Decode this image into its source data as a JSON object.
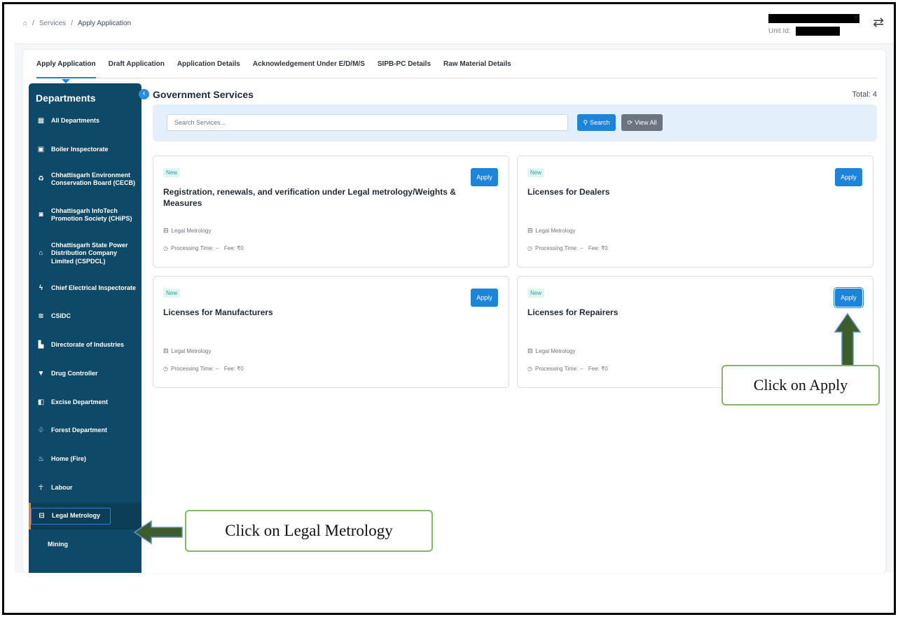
{
  "breadcrumb": {
    "sep": "/",
    "items": [
      "Services",
      "Apply Application"
    ]
  },
  "user": {
    "unit_label": "Unit Id:",
    "name_tail": "V"
  },
  "tabs": [
    {
      "label": "Apply Application",
      "active": true
    },
    {
      "label": "Draft Application",
      "active": false
    },
    {
      "label": "Application Details",
      "active": false
    },
    {
      "label": "Acknowledgement Under E/D/M/S",
      "active": false
    },
    {
      "label": "SIPB-PC Details",
      "active": false
    },
    {
      "label": "Raw Material Details",
      "active": false
    }
  ],
  "sidebar": {
    "title": "Departments",
    "items": [
      {
        "label": "All Departments",
        "icon": "grid-icon"
      },
      {
        "label": "Boiler Inspectorate",
        "icon": "boiler-icon"
      },
      {
        "label": "Chhattisgarh Environment Conservation Board (CECB)",
        "icon": "recycle-icon"
      },
      {
        "label": "Chhattisgarh InfoTech Promotion Society (CHiPS)",
        "icon": "chip-icon"
      },
      {
        "label": "Chhattisgarh State Power Distribution Company Limited (CSPDCL)",
        "icon": "power-icon"
      },
      {
        "label": "Chief Electrical Inspectorate",
        "icon": "bolt-icon"
      },
      {
        "label": "CSIDC",
        "icon": "building-icon"
      },
      {
        "label": "Directorate of Industries",
        "icon": "factory-icon"
      },
      {
        "label": "Drug Controller",
        "icon": "pill-icon"
      },
      {
        "label": "Excise Department",
        "icon": "bottle-icon"
      },
      {
        "label": "Forest Department",
        "icon": "tree-icon"
      },
      {
        "label": "Home (Fire)",
        "icon": "fire-icon"
      },
      {
        "label": "Labour",
        "icon": "worker-icon"
      },
      {
        "label": "Legal Metrology",
        "icon": "scale-icon",
        "selected": true
      },
      {
        "label": "Mining",
        "icon": ""
      }
    ]
  },
  "main": {
    "title": "Government Services",
    "total": "Total: 4",
    "search_placeholder": "Search Services...",
    "search_label": "Search",
    "view_all_label": "View All",
    "cards": [
      {
        "badge": "New",
        "title": "Registration, renewals, and verification under Legal metrology/Weights & Measures",
        "apply": "Apply",
        "department": "Legal Metrology",
        "processing": "Processing Time: --",
        "fee": "Fee: ₹0"
      },
      {
        "badge": "New",
        "title": "Licenses for Dealers",
        "apply": "Apply",
        "department": "Legal Metrology",
        "processing": "Processing Time: --",
        "fee": "Fee: ₹0"
      },
      {
        "badge": "New",
        "title": "Licenses for Manufacturers",
        "apply": "Apply",
        "department": "Legal Metrology",
        "processing": "Processing Time: --",
        "fee": "Fee: ₹0"
      },
      {
        "badge": "New",
        "title": "Licenses for Repairers",
        "apply": "Apply",
        "department": "Legal Metrology",
        "processing": "Processing Time: --",
        "fee": "Fee: ₹0"
      }
    ]
  },
  "callouts": {
    "apply": "Click on Apply",
    "legal_metrology": "Click on Legal Metrology"
  },
  "colors": {
    "sidebar_bg": "#0e4a68",
    "primary_button": "#1d84d9",
    "callout_border": "#84b566",
    "arrow": "#3d5e2a"
  }
}
